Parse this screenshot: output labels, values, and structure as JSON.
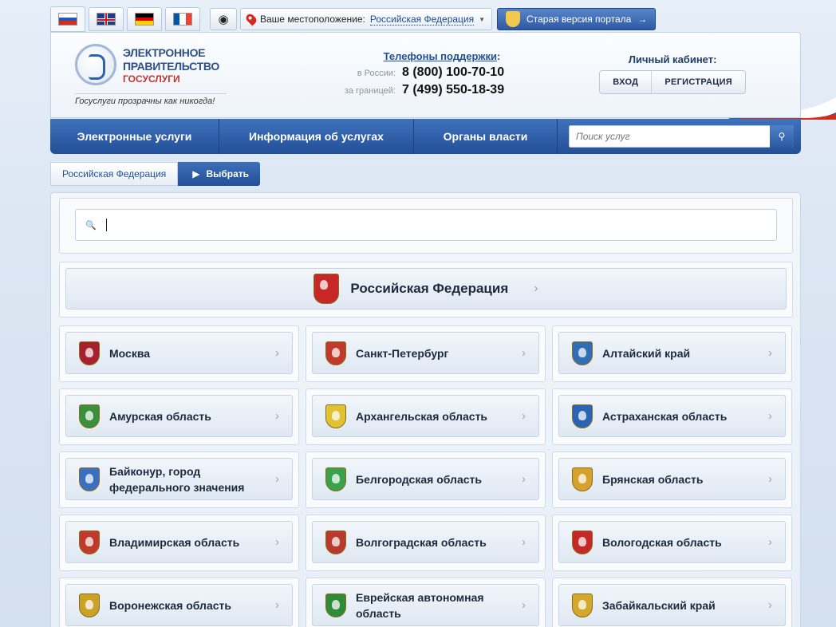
{
  "topbar": {
    "languages": [
      {
        "code": "ru",
        "icon": "flag-ru-icon",
        "active": true
      },
      {
        "code": "en",
        "icon": "flag-gb-icon",
        "active": false
      },
      {
        "code": "de",
        "icon": "flag-de-icon",
        "active": false
      },
      {
        "code": "fr",
        "icon": "flag-fr-icon",
        "active": false
      }
    ],
    "accessibility_icon": "eye-icon",
    "location_label": "Ваше местоположение:",
    "location_value": "Российская Федерация",
    "old_portal_label": "Старая версия портала"
  },
  "header": {
    "logo_line1": "ЭЛЕКТРОННОЕ",
    "logo_line2": "ПРАВИТЕЛЬСТВО",
    "logo_line3": "ГОСУСЛУГИ",
    "slogan": "Госуслуги прозрачны как никогда!",
    "phones_title": "Телефоны поддержки",
    "phones_colon": ":",
    "phone_ru_label": "в России:",
    "phone_ru": "8 (800) 100-70-10",
    "phone_abroad_label": "за границей:",
    "phone_abroad": "7 (499) 550-18-39",
    "cabinet_title": "Личный кабинет:",
    "login_label": "ВХОД",
    "register_label": "РЕГИСТРАЦИЯ"
  },
  "nav": {
    "items": [
      "Электронные услуги",
      "Информация об услугах",
      "Органы власти"
    ],
    "search_placeholder": "Поиск услуг"
  },
  "breadcrumb": {
    "root": "Российская Федерация",
    "current": "Выбрать"
  },
  "federation": {
    "label": "Российская Федерация",
    "icon": "russia-coat-of-arms-icon"
  },
  "regions": [
    {
      "label": "Москва",
      "color": "#a8202e"
    },
    {
      "label": "Санкт-Петербург",
      "color": "#c0392b"
    },
    {
      "label": "Алтайский край",
      "color": "#2f6db5"
    },
    {
      "label": "Амурская область",
      "color": "#3a8f3a"
    },
    {
      "label": "Архангельская область",
      "color": "#e1c232"
    },
    {
      "label": "Астраханская область",
      "color": "#2c64b5"
    },
    {
      "label": "Байконур, город федерального значения",
      "color": "#3a6fc2"
    },
    {
      "label": "Белгородская область",
      "color": "#3aa24a"
    },
    {
      "label": "Брянская область",
      "color": "#d6a22b"
    },
    {
      "label": "Владимирская область",
      "color": "#c0392b"
    },
    {
      "label": "Волгоградская область",
      "color": "#b83a2e"
    },
    {
      "label": "Вологодская область",
      "color": "#c62828"
    },
    {
      "label": "Воронежская область",
      "color": "#c9a227"
    },
    {
      "label": "Еврейская автономная область",
      "color": "#2e8b3a"
    },
    {
      "label": "Забайкальский край",
      "color": "#d4a82a"
    }
  ]
}
